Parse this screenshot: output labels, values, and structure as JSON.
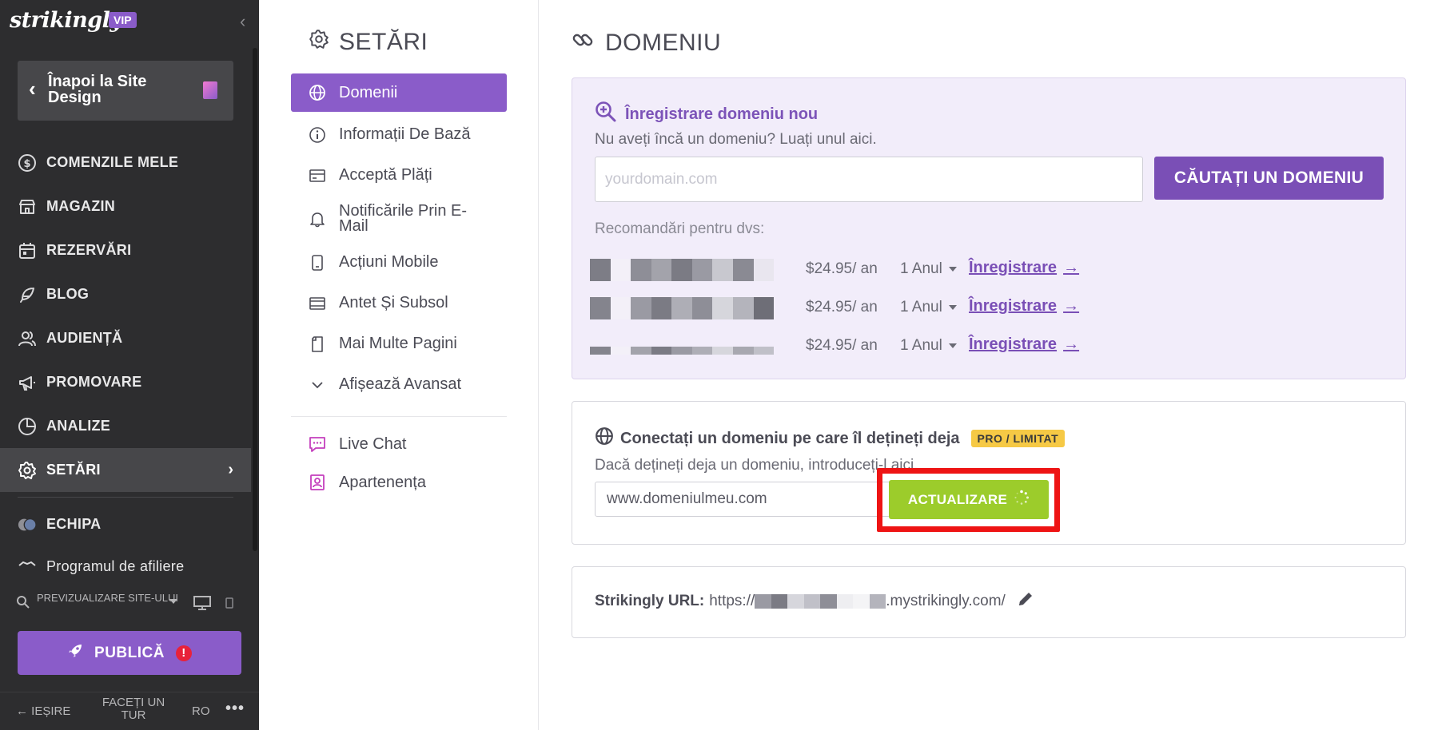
{
  "sidebar": {
    "logo": "strikingly",
    "vip": "VIP",
    "back_label": "Înapoi la Site Design",
    "nav": [
      {
        "label": "COMENZILE MELE",
        "icon": "dollar-circle-icon"
      },
      {
        "label": "MAGAZIN",
        "icon": "store-icon"
      },
      {
        "label": "REZERVĂRI",
        "icon": "calendar-icon"
      },
      {
        "label": "BLOG",
        "icon": "feather-icon"
      },
      {
        "label": "AUDIENȚĂ",
        "icon": "users-icon"
      },
      {
        "label": "PROMOVARE",
        "icon": "megaphone-icon"
      },
      {
        "label": "ANALIZE",
        "icon": "pie-chart-icon"
      },
      {
        "label": "SETĂRI",
        "icon": "gear-icon",
        "active": true
      }
    ],
    "team_label": "ECHIPA",
    "affiliate_label": "Programul de afiliere",
    "preview_label": "PREVIZUALIZARE SITE-ULUI",
    "publish_label": "PUBLICĂ",
    "publish_alert": "!",
    "footer": {
      "exit": "IEȘIRE",
      "tour": "FACEȚI UN TUR",
      "lang": "RO",
      "more": "•••"
    }
  },
  "settings": {
    "title": "SETĂRI",
    "items": [
      {
        "label": "Domenii",
        "icon": "globe-icon",
        "active": true
      },
      {
        "label": "Informații De Bază",
        "icon": "info-icon"
      },
      {
        "label": "Acceptă Plăți",
        "icon": "payment-card-icon"
      },
      {
        "label": "Notificările Prin E-Mail",
        "icon": "bell-icon"
      },
      {
        "label": "Acțiuni Mobile",
        "icon": "mobile-icon"
      },
      {
        "label": "Antet Și Subsol",
        "icon": "header-footer-icon"
      },
      {
        "label": "Mai Multe Pagini",
        "icon": "pages-icon"
      },
      {
        "label": "Afișează Avansat",
        "icon": "chevron-down-icon"
      }
    ],
    "extra": [
      {
        "label": "Live Chat",
        "icon": "chat-icon"
      },
      {
        "label": "Apartenența",
        "icon": "membership-icon"
      }
    ]
  },
  "main": {
    "title": "DOMENIU",
    "register": {
      "heading": "Înregistrare domeniu nou",
      "subtitle": "Nu aveți încă un domeniu? Luați unul aici.",
      "placeholder": "yourdomain.com",
      "search_button": "CĂUTAȚI UN DOMENIU",
      "recommendations_label": "Recomandări pentru dvs:",
      "rows": [
        {
          "price": "$24.95/ an",
          "period": "1 Anul",
          "action": "Înregistrare"
        },
        {
          "price": "$24.95/ an",
          "period": "1 Anul",
          "action": "Înregistrare"
        },
        {
          "price": "$24.95/ an",
          "period": "1 Anul",
          "action": "Înregistrare"
        }
      ]
    },
    "connect": {
      "heading": "Conectați un domeniu pe care îl dețineți deja",
      "badge": "PRO / LIMITAT",
      "subtitle": "Dacă dețineți deja un domeniu, introduceți-l aici.",
      "input_value": "www.domeniulmeu.com",
      "button": "ACTUALIZARE"
    },
    "url": {
      "label": "Strikingly URL:",
      "prefix": "https://",
      "suffix": ".mystrikingly.com/"
    }
  },
  "colors": {
    "accent": "#8a5cc9",
    "sidebar_bg": "#2d2d2f",
    "upgrade_green": "#9ccc2b",
    "highlight_red": "#ee1414",
    "badge_yellow": "#f6c945"
  }
}
